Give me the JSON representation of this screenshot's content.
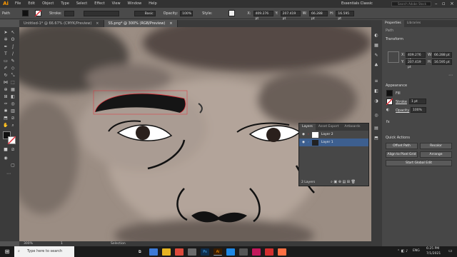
{
  "app": {
    "logo": "Ai",
    "menu": [
      "File",
      "Edit",
      "Object",
      "Type",
      "Select",
      "Effect",
      "View",
      "Window",
      "Help"
    ],
    "workspace": "Essentials Classic",
    "search_placeholder": "Search Adobe Stock"
  },
  "control_bar": {
    "selection_label": "Path",
    "stroke_label": "Stroke:",
    "brush": "Basic",
    "opacity_label": "Opacity:",
    "opacity": "100%",
    "style_label": "Style:",
    "x_label": "X:",
    "x": "409.276 pt",
    "y_label": "Y:",
    "y": "207.419 pt",
    "w_label": "W:",
    "w": "66.288 pt",
    "h_label": "H:",
    "h": "16.595 pt"
  },
  "tabs": [
    {
      "label": "Untitled-1* @ 66.67% (CMYK/Preview)",
      "close": "×"
    },
    {
      "label": "SS.png* @ 300% (RGB/Preview)",
      "close": "×"
    }
  ],
  "status": {
    "zoom": "300%",
    "page": "1",
    "tool": "Selection"
  },
  "properties": {
    "tabs": [
      "Properties",
      "Libraries"
    ],
    "object": "Path",
    "transform_title": "Transform",
    "x_label": "X:",
    "x": "409.276 pt",
    "y_label": "Y:",
    "y": "207.419 pt",
    "w_label": "W:",
    "w": "66.288 pt",
    "h_label": "H:",
    "h": "16.595 pt",
    "appearance_title": "Appearance",
    "fill_label": "Fill",
    "stroke_label": "Stroke",
    "stroke_value": "1 pt",
    "opacity_label": "Opacity",
    "opacity": "100%",
    "quick_actions_title": "Quick Actions",
    "actions": [
      "Offset Path",
      "Recolor",
      "Align to Pixel Grid",
      "Arrange",
      "Start Global Edit"
    ]
  },
  "layers": {
    "tabs": [
      "Layers",
      "Asset Export",
      "Artboards"
    ],
    "rows": [
      "Layer 2",
      "Layer 1"
    ],
    "footer": "2 Layers"
  },
  "taskbar": {
    "search_placeholder": "Type here to search",
    "time": "6:25 PM",
    "date": "7/1/2021",
    "lang": "ENG"
  },
  "colors": {
    "accent": "#ff9a00",
    "selection": "#e0303a",
    "panel": "#474747"
  }
}
